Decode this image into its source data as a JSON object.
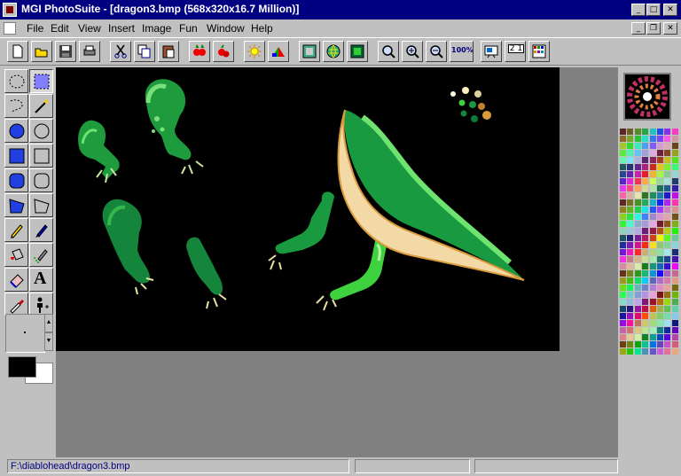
{
  "window": {
    "title": "MGI PhotoSuite - [dragon3.bmp (568x320x16.7 Million)]"
  },
  "menu": {
    "items": [
      "File",
      "Edit",
      "View",
      "Insert",
      "Image",
      "Fun",
      "Window",
      "Help"
    ]
  },
  "toolbar": {
    "zoom_label": "100%",
    "page_label": "2 1"
  },
  "status": {
    "path": "F:\\diablohead\\dragon3.bmp"
  },
  "colors": {
    "title_bg": "#000080",
    "workspace": "#808080",
    "canvas": "#000000",
    "dragon_dark": "#0e7a3a",
    "dragon_light": "#3fd23f",
    "belly": "#f3d9a6"
  },
  "icons": [
    "new-icon",
    "open-icon",
    "save-icon",
    "print-icon",
    "cut-icon",
    "copy-icon",
    "paste-icon",
    "brightness-icon",
    "color-icon",
    "frame-icon",
    "globe-icon",
    "export-icon",
    "zoom-icon",
    "zoom-in-icon",
    "zoom-out-icon",
    "zoom-100-icon",
    "slideshow-icon",
    "page-icon",
    "thumbnails-icon"
  ]
}
